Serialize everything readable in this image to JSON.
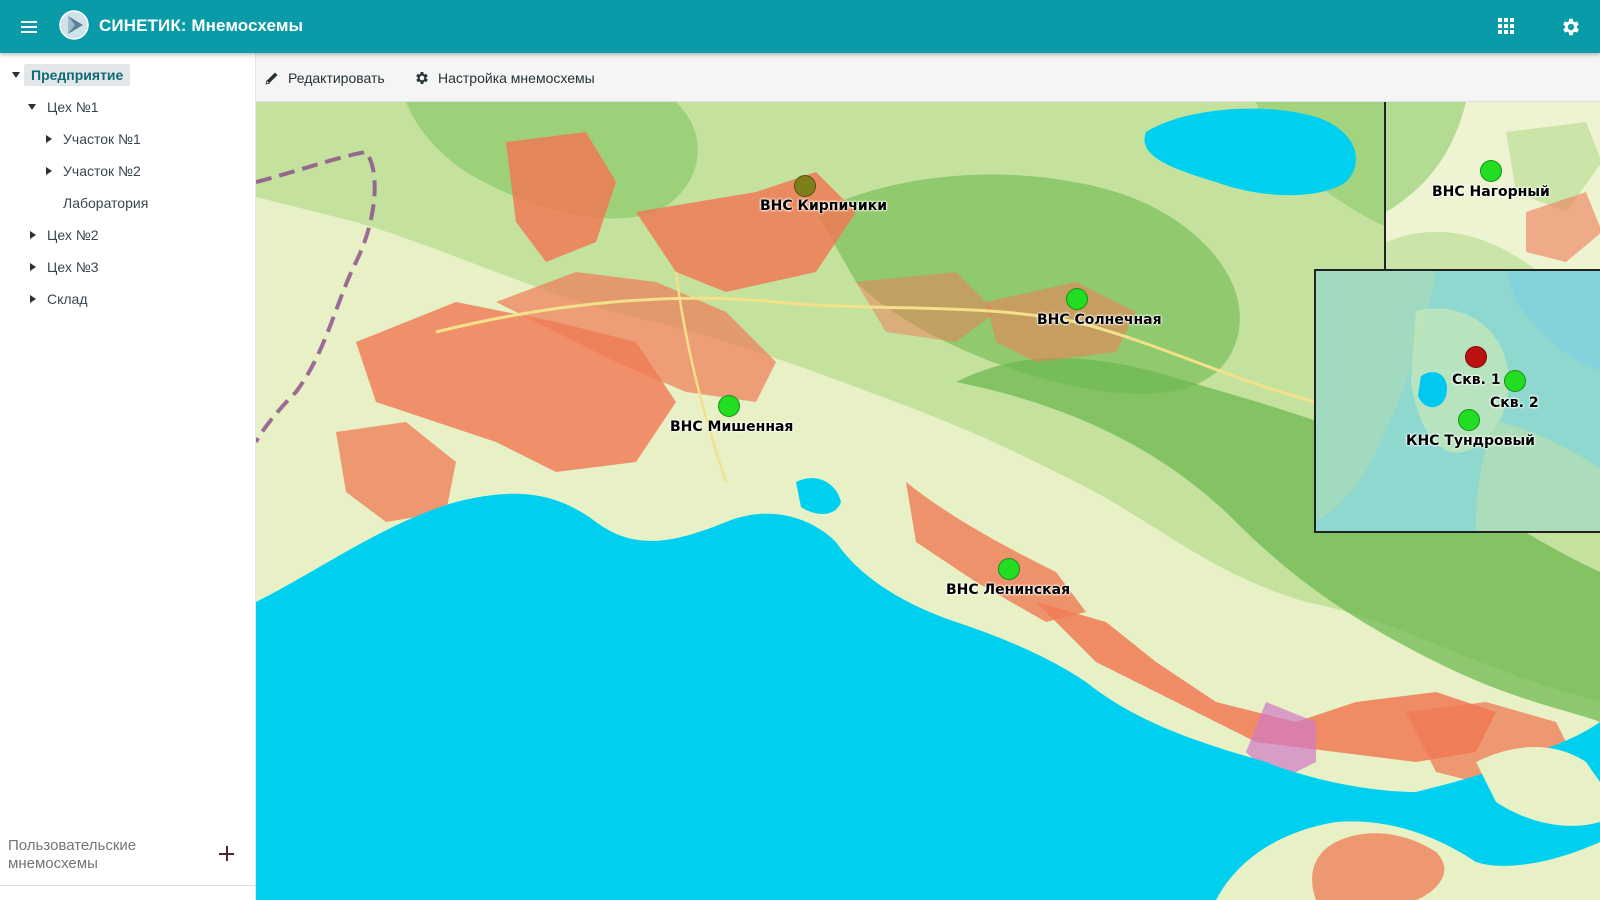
{
  "header": {
    "title": "СИНЕТИК: Мнемосхемы",
    "icons": [
      "menu-icon",
      "logo-icon",
      "apps-grid-icon",
      "settings-gear-icon"
    ],
    "color": "#0a9ba8"
  },
  "toolbar": {
    "edit_label": "Редактировать",
    "settings_label": "Настройка мнемосхемы"
  },
  "sidebar": {
    "tree": [
      {
        "label": "Предприятие",
        "expanded": true,
        "selected": true
      },
      {
        "label": "Цех №1",
        "expanded": true
      },
      {
        "label": "Участок №1",
        "expanded": false
      },
      {
        "label": "Участок №2",
        "expanded": false
      },
      {
        "label": "Лаборатория",
        "leaf": true
      },
      {
        "label": "Цех №2",
        "expanded": false
      },
      {
        "label": "Цех №3",
        "expanded": false
      },
      {
        "label": "Склад",
        "expanded": false
      }
    ],
    "user_schemes_label": "Пользовательские мнемосхемы"
  },
  "map": {
    "stations": [
      {
        "label": "ВНС Кирпичики",
        "status": "warning",
        "color": "#7f7f1a"
      },
      {
        "label": "ВНС Солнечная",
        "status": "ok",
        "color": "#22dd22"
      },
      {
        "label": "ВНС Мишенная",
        "status": "ok",
        "color": "#22dd22"
      },
      {
        "label": "ВНС Ленинская",
        "status": "ok",
        "color": "#22dd22"
      },
      {
        "label": "ВНС Нагорный",
        "status": "ok",
        "color": "#22dd22"
      },
      {
        "label": "Скв. 1",
        "status": "alarm",
        "color": "#bb1111"
      },
      {
        "label": "Скв. 2",
        "status": "ok",
        "color": "#22dd22"
      },
      {
        "label": "КНС Тундровый",
        "status": "ok",
        "color": "#22dd22"
      }
    ],
    "colors": {
      "sea": "#00d0f0",
      "land": "#e7f1c5",
      "forest": "#85c668",
      "urban": "#f07a55"
    }
  }
}
